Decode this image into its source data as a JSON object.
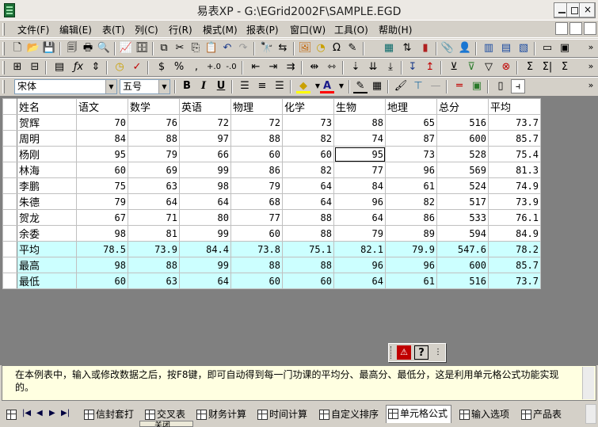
{
  "window": {
    "title": "易表XP  -  G:\\EGrid2002F\\SAMPLE.EGD"
  },
  "menu": [
    "文件(F)",
    "编辑(E)",
    "表(T)",
    "列(C)",
    "行(R)",
    "模式(M)",
    "报表(P)",
    "窗口(W)",
    "工具(O)",
    "帮助(H)"
  ],
  "format_toolbar": {
    "font_name": "宋体",
    "font_size": "五号",
    "bold": "B",
    "italic": "I",
    "underline": "U"
  },
  "grid": {
    "columns": [
      "姓名",
      "语文",
      "数学",
      "英语",
      "物理",
      "化学",
      "生物",
      "地理",
      "总分",
      "平均"
    ],
    "rows": [
      [
        "贺辉",
        "70",
        "76",
        "72",
        "72",
        "73",
        "88",
        "65",
        "516",
        "73.7"
      ],
      [
        "周明",
        "84",
        "88",
        "97",
        "88",
        "82",
        "74",
        "87",
        "600",
        "85.7"
      ],
      [
        "杨刚",
        "95",
        "79",
        "66",
        "60",
        "60",
        "95",
        "73",
        "528",
        "75.4"
      ],
      [
        "林海",
        "60",
        "69",
        "99",
        "86",
        "82",
        "77",
        "96",
        "569",
        "81.3"
      ],
      [
        "李鹏",
        "75",
        "63",
        "98",
        "79",
        "64",
        "84",
        "61",
        "524",
        "74.9"
      ],
      [
        "朱德",
        "79",
        "64",
        "64",
        "68",
        "64",
        "96",
        "82",
        "517",
        "73.9"
      ],
      [
        "贺龙",
        "67",
        "71",
        "80",
        "77",
        "88",
        "64",
        "86",
        "533",
        "76.1"
      ],
      [
        "余委",
        "98",
        "81",
        "99",
        "60",
        "88",
        "79",
        "89",
        "594",
        "84.9"
      ]
    ],
    "stat_rows": [
      [
        "平均",
        "78.5",
        "73.9",
        "84.4",
        "73.8",
        "75.1",
        "82.1",
        "79.9",
        "547.6",
        "78.2"
      ],
      [
        "最高",
        "98",
        "88",
        "99",
        "88",
        "88",
        "96",
        "96",
        "600",
        "85.7"
      ],
      [
        "最低",
        "60",
        "63",
        "64",
        "60",
        "60",
        "64",
        "61",
        "516",
        "73.7"
      ]
    ],
    "stat_color": "#ccffff"
  },
  "description": "在本例表中，输入或修改数据之后，按F8键，即可自动得到每一门功课的平均分、最高分、最低分，这是利用单元格公式功能实现的。",
  "tabs": [
    "信封套打",
    "交叉表",
    "财务计算",
    "时间计算",
    "自定义排序",
    "单元格公式",
    "输入选项",
    "产品表"
  ],
  "active_tab": "单元格公式",
  "popup_label": "关闭"
}
